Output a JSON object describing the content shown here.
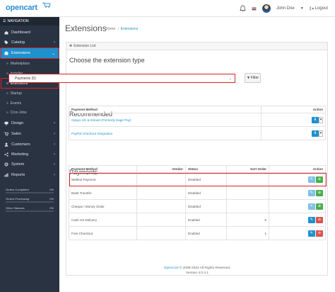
{
  "header": {
    "logo": "opencart",
    "user_name": "John Doe",
    "logout_label": "Logout"
  },
  "sidebar": {
    "nav_title": "NAVIGATION",
    "items": [
      {
        "label": "Dashboard",
        "icon": "home-icon"
      },
      {
        "label": "Catalog",
        "icon": "tag-icon"
      },
      {
        "label": "Extensions",
        "icon": "puzzle-icon"
      },
      {
        "label": "Design",
        "icon": "monitor-icon"
      },
      {
        "label": "Sales",
        "icon": "cart-icon"
      },
      {
        "label": "Customers",
        "icon": "user-icon"
      },
      {
        "label": "Marketing",
        "icon": "share-icon"
      },
      {
        "label": "System",
        "icon": "gear-icon"
      },
      {
        "label": "Reports",
        "icon": "bar-chart-icon"
      }
    ],
    "sub_items": [
      "Marketplace",
      "Installer",
      "Extensions",
      "Startup",
      "Events",
      "Cron Jobs"
    ],
    "stats": [
      {
        "label": "Orders Completed",
        "value": "0%"
      },
      {
        "label": "Orders Processing",
        "value": "0%"
      },
      {
        "label": "Other Statuses",
        "value": "0%"
      }
    ]
  },
  "page": {
    "title": "Extensions",
    "breadcrumb_home": "Home",
    "breadcrumb_current": "Extensions",
    "panel_title": "Extension List",
    "choose_heading": "Choose the extension type",
    "select_value": "Payments (5)",
    "filter_label": "Filter",
    "recommended_heading": "Recommended",
    "payments_heading": "Payments"
  },
  "recommended": {
    "headers": [
      "Payment Method",
      "Action"
    ],
    "rows": [
      {
        "name": "Opayo UK & Ireland (Formerly Sage Pay)"
      },
      {
        "name": "PayPal Checkout Integration"
      }
    ]
  },
  "payments": {
    "headers": [
      "Payment Method",
      "Vendor",
      "Status",
      "Sort Order",
      "Action"
    ],
    "rows": [
      {
        "name": "Webkul Payment",
        "vendor": "",
        "status": "Disabled",
        "sort": "",
        "installed": false
      },
      {
        "name": "Bank Transfer",
        "vendor": "",
        "status": "Disabled",
        "sort": "",
        "installed": false
      },
      {
        "name": "Cheque / Money Order",
        "vendor": "",
        "status": "Disabled",
        "sort": "",
        "installed": false
      },
      {
        "name": "Cash On Delivery",
        "vendor": "",
        "status": "Enabled",
        "sort": "5",
        "installed": true
      },
      {
        "name": "Free Checkout",
        "vendor": "",
        "status": "Enabled",
        "sort": "1",
        "installed": true
      }
    ]
  },
  "footer": {
    "brand": "OpenCart",
    "copyright": "© 2009-2022 All Rights Reserved.",
    "version": "Version 4.0.2.1"
  },
  "colors": {
    "accent": "#1e91cf",
    "sidebar": "#2a3342",
    "highlight": "#d8232a",
    "install_green": "#4cae4c",
    "uninstall_red": "#d9534f"
  }
}
